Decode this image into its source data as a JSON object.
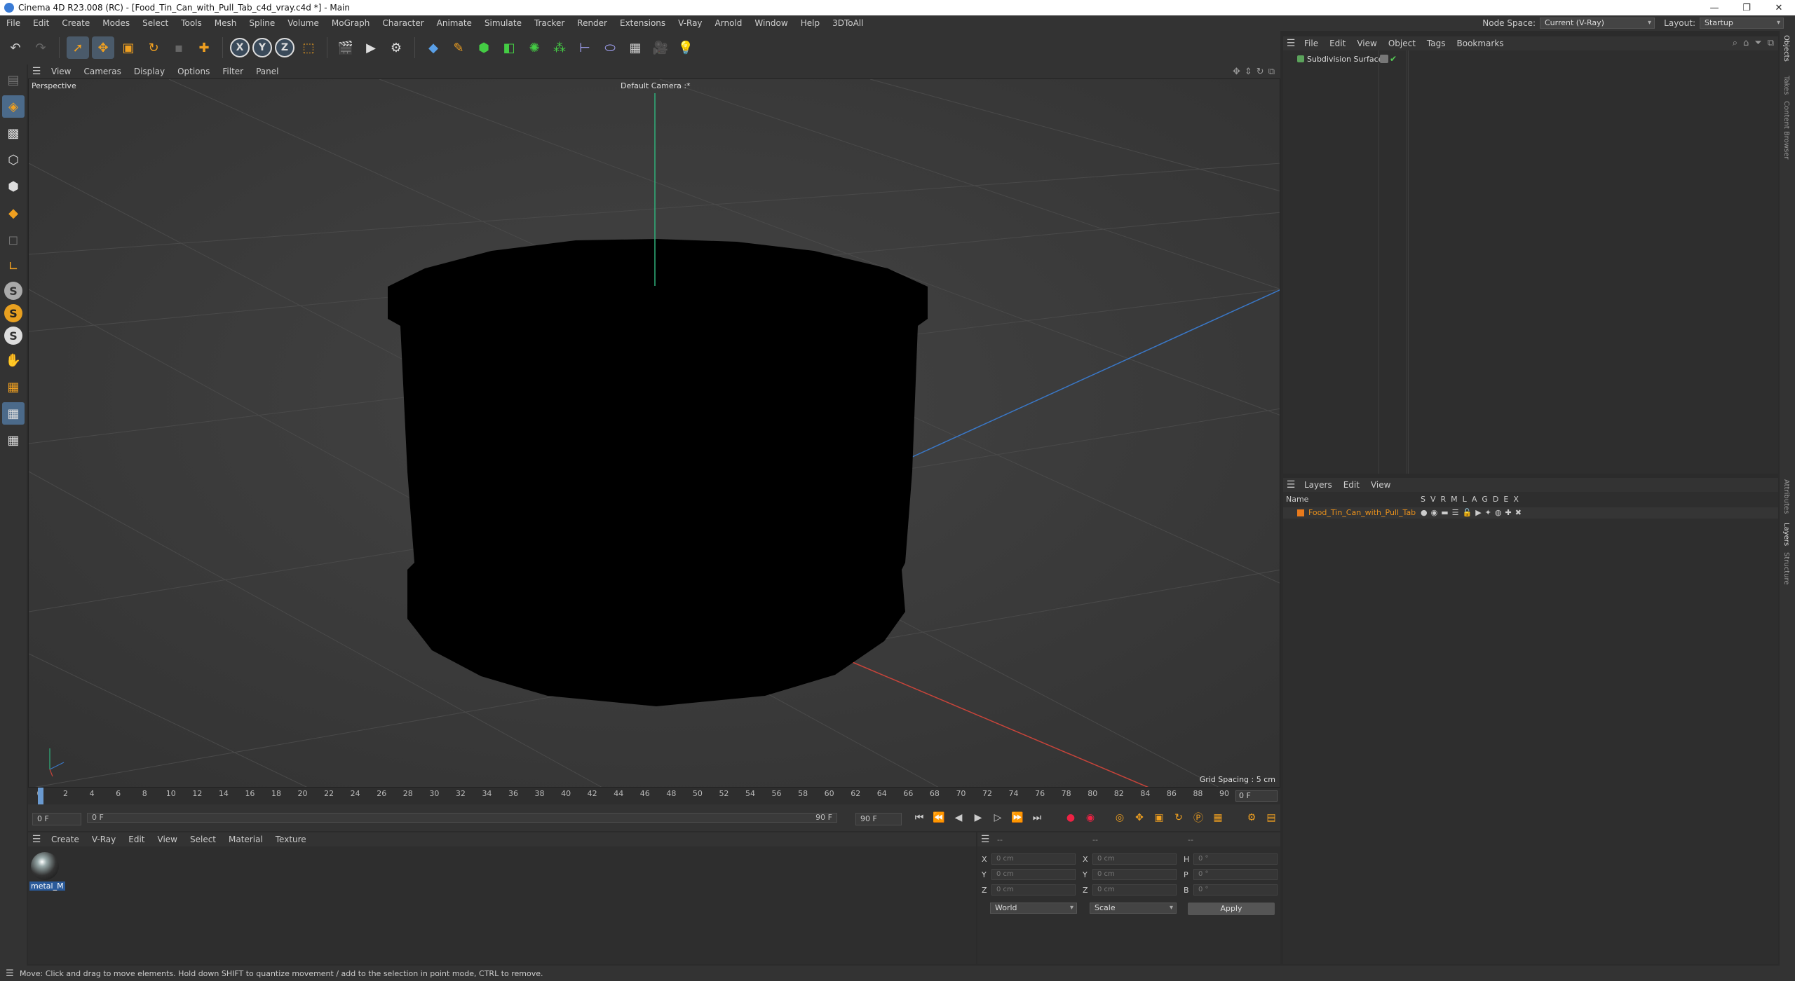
{
  "window": {
    "title": "Cinema 4D R23.008 (RC) - [Food_Tin_Can_with_Pull_Tab_c4d_vray.c4d *] - Main",
    "controls": [
      "—",
      "❐",
      "✕"
    ]
  },
  "menubar": {
    "items": [
      "File",
      "Edit",
      "Create",
      "Modes",
      "Select",
      "Tools",
      "Mesh",
      "Spline",
      "Volume",
      "MoGraph",
      "Character",
      "Animate",
      "Simulate",
      "Tracker",
      "Render",
      "Extensions",
      "V-Ray",
      "Arnold",
      "Window",
      "Help",
      "3DToAll"
    ],
    "node_space_label": "Node Space:",
    "node_space_value": "Current (V-Ray)",
    "layout_label": "Layout:",
    "layout_value": "Startup"
  },
  "toolbar": {
    "axis": [
      "X",
      "Y",
      "Z"
    ]
  },
  "viewport": {
    "menu": [
      "View",
      "Cameras",
      "Display",
      "Options",
      "Filter",
      "Panel"
    ],
    "label": "Perspective",
    "camera": "Default Camera :*",
    "grid_spacing": "Grid Spacing : 5 cm"
  },
  "timeline": {
    "ticks": [
      "0",
      "2",
      "4",
      "6",
      "8",
      "10",
      "12",
      "14",
      "16",
      "18",
      "20",
      "22",
      "24",
      "26",
      "28",
      "30",
      "32",
      "34",
      "36",
      "38",
      "40",
      "42",
      "44",
      "46",
      "48",
      "50",
      "52",
      "54",
      "56",
      "58",
      "60",
      "62",
      "64",
      "66",
      "68",
      "70",
      "72",
      "74",
      "76",
      "78",
      "80",
      "82",
      "84",
      "86",
      "88",
      "90"
    ],
    "current_frame": "0 F",
    "start_field": "0 F",
    "slider_left": "0 F",
    "slider_right": "90 F",
    "end_field": "90 F"
  },
  "materials": {
    "menu": [
      "Create",
      "V-Ray",
      "Edit",
      "View",
      "Select",
      "Material",
      "Texture"
    ],
    "items": [
      {
        "name": "metal_M"
      }
    ]
  },
  "coordinates": {
    "header": [
      "--",
      "--",
      "--"
    ],
    "rows": [
      {
        "a": "X",
        "av": "0 cm",
        "b": "X",
        "bv": "0 cm",
        "c": "H",
        "cv": "0 °"
      },
      {
        "a": "Y",
        "av": "0 cm",
        "b": "Y",
        "bv": "0 cm",
        "c": "P",
        "cv": "0 °"
      },
      {
        "a": "Z",
        "av": "0 cm",
        "b": "Z",
        "bv": "0 cm",
        "c": "B",
        "cv": "0 °"
      }
    ],
    "mode1": "World",
    "mode2": "Scale",
    "apply": "Apply"
  },
  "objects": {
    "menu": [
      "File",
      "Edit",
      "View",
      "Object",
      "Tags",
      "Bookmarks"
    ],
    "items": [
      {
        "name": "Subdivision Surface"
      }
    ]
  },
  "layers": {
    "menu": [
      "Layers",
      "Edit",
      "View"
    ],
    "header_name": "Name",
    "header_cols": [
      "S",
      "V",
      "R",
      "M",
      "L",
      "A",
      "G",
      "D",
      "E",
      "X"
    ],
    "items": [
      {
        "name": "Food_Tin_Can_with_Pull_Tab"
      }
    ]
  },
  "right_tabs": [
    "Objects",
    "Takes",
    "Content Browser",
    "Attributes",
    "Layers",
    "Structure"
  ],
  "status": {
    "text": "Move: Click and drag to move elements. Hold down SHIFT to quantize movement / add to the selection in point mode, CTRL to remove."
  },
  "colors": {
    "accent": "#e8901c",
    "axis_y": "#2fb07a",
    "axis_x": "#c8443a",
    "axis_z": "#3a78c8"
  }
}
